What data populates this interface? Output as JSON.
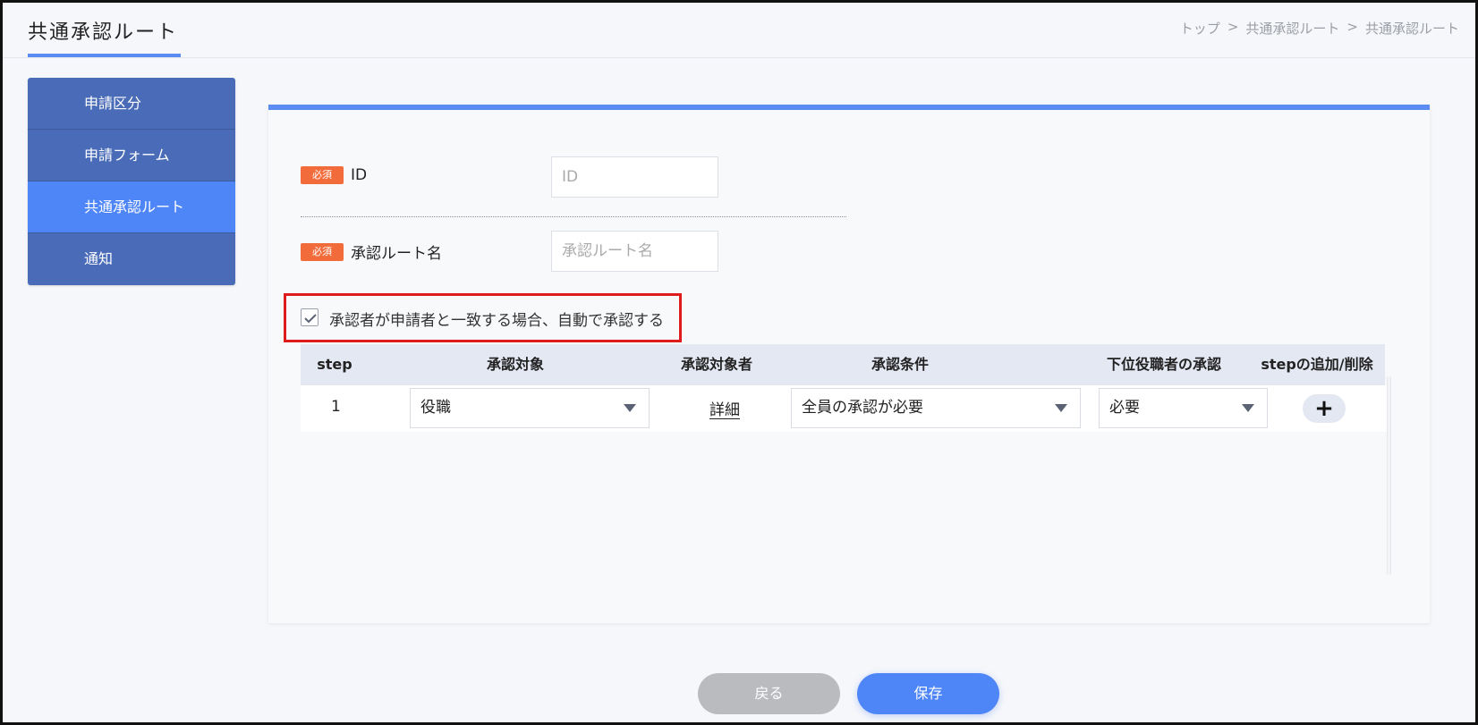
{
  "header": {
    "title": "共通承認ルート",
    "breadcrumb": [
      "トップ",
      "共通承認ルート",
      "共通承認ルート"
    ],
    "breadcrumb_sep": ">"
  },
  "sidebar": {
    "items": [
      {
        "label": "申請区分"
      },
      {
        "label": "申請フォーム"
      },
      {
        "label": "共通承認ルート"
      },
      {
        "label": "通知"
      }
    ]
  },
  "form": {
    "required_badge": "必須",
    "id_label": "ID",
    "id_placeholder": "ID",
    "route_name_label": "承認ルート名",
    "route_name_placeholder": "承認ルート名",
    "auto_approve_label": "承認者が申請者と一致する場合、自動で承認する",
    "auto_approve_checked": true
  },
  "table": {
    "headers": [
      "step",
      "承認対象",
      "承認対象者",
      "承認条件",
      "下位役職者の承認",
      "stepの追加/削除"
    ],
    "rows": [
      {
        "step": "1",
        "target": "役職",
        "approver_link": "詳細",
        "condition": "全員の承認が必要",
        "subordinate": "必要",
        "add": "+"
      }
    ]
  },
  "footer": {
    "back_label": "戻る",
    "save_label": "保存"
  },
  "colors": {
    "accent": "#4f86f7",
    "sidebar": "#4a6cb8",
    "required": "#f26b3a",
    "highlight": "#e01b1b"
  }
}
